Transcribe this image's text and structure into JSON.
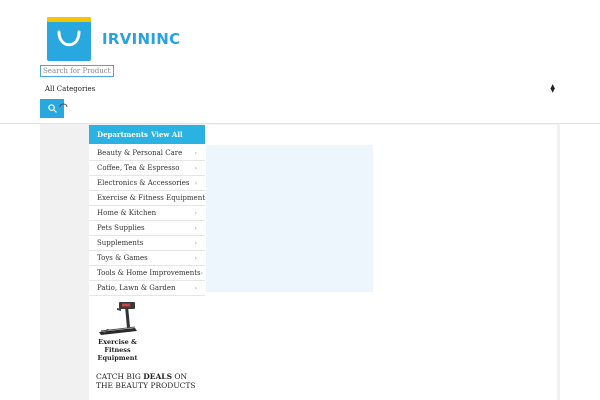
{
  "brand": {
    "name": "IRVININC",
    "accent": "#29a3e0"
  },
  "search": {
    "placeholder": "Search for Products",
    "icon": "search-icon"
  },
  "category_select": {
    "selected": "All Categories"
  },
  "departments": {
    "title": "Departments",
    "view_all": "View All",
    "items": [
      {
        "label": "Beauty & Personal Care"
      },
      {
        "label": "Coffee, Tea & Espresso"
      },
      {
        "label": "Electronics & Accessories"
      },
      {
        "label": "Exercise & Fitness Equipment"
      },
      {
        "label": "Home & Kitchen"
      },
      {
        "label": "Pets Supplies"
      },
      {
        "label": "Supplements"
      },
      {
        "label": "Toys & Games"
      },
      {
        "label": "Tools & Home Improvements"
      },
      {
        "label": "Patio, Lawn & Garden"
      }
    ],
    "arrow": "›"
  },
  "promo": {
    "caption": "Exercise & Fitness Equipment",
    "image": "treadmill"
  },
  "deal": {
    "pre": "CATCH BIG ",
    "highlight": "DEALS",
    "post": " ON THE BEAUTY PRODUCTS"
  }
}
